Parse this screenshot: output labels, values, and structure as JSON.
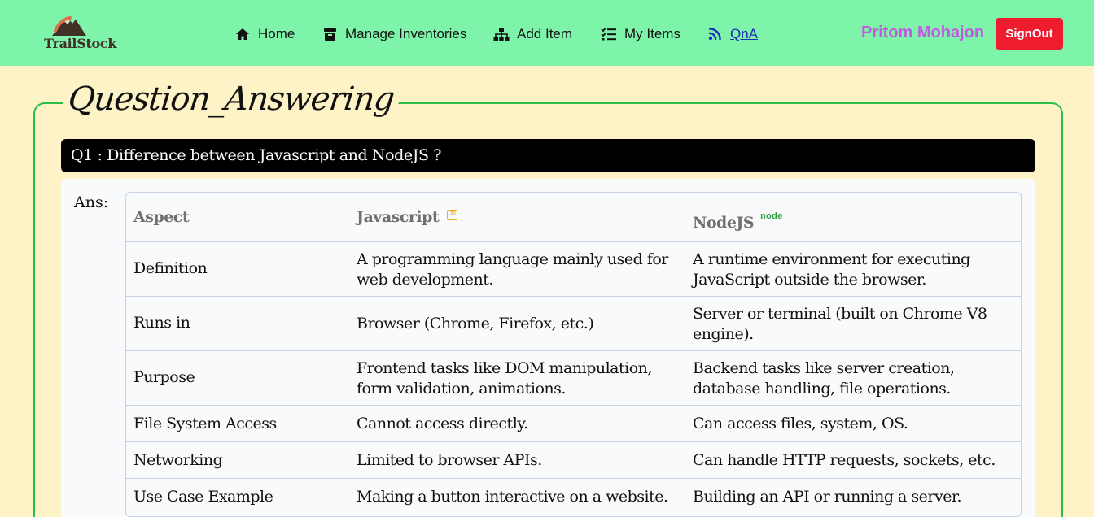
{
  "brand": {
    "name": "TrailStock",
    "logo_icon": "mountain-logo-icon"
  },
  "nav": {
    "items": [
      {
        "label": "Home",
        "icon": "home-icon"
      },
      {
        "label": "Manage Inventories",
        "icon": "archive-box-icon"
      },
      {
        "label": "Add Item",
        "icon": "sitemap-icon"
      },
      {
        "label": "My Items",
        "icon": "list-check-icon"
      },
      {
        "label": "QnA",
        "icon": "podcast-icon",
        "active": true
      }
    ],
    "user_name": "Pritom Mohajon",
    "signout_label": "SignOut"
  },
  "page": {
    "legend": "Question_Answering",
    "question": "Q1 : Difference between Javascript and NodeJS ?",
    "answer_label": "Ans:"
  },
  "table": {
    "headers": [
      "Aspect",
      "Javascript",
      "NodeJS"
    ],
    "header_badges": {
      "javascript": "JS",
      "nodejs": "node"
    },
    "rows": [
      [
        "Definition",
        "A programming language mainly used for web development.",
        "A runtime environment for executing JavaScript outside the browser."
      ],
      [
        "Runs in",
        "Browser (Chrome, Firefox, etc.)",
        "Server or terminal (built on Chrome V8 engine)."
      ],
      [
        "Purpose",
        "Frontend tasks like DOM manipulation, form validation, animations.",
        "Backend tasks like server creation, database handling, file operations."
      ],
      [
        "File System Access",
        "Cannot access directly.",
        "Can access files, system, OS."
      ],
      [
        "Networking",
        "Limited to browser APIs.",
        "Can handle HTTP requests, sockets, etc."
      ],
      [
        "Use Case Example",
        "Making a button interactive on a website.",
        "Building an API or running a server."
      ]
    ]
  },
  "colors": {
    "navbar_bg": "#7ef4aa",
    "page_bg": "#fef3c7",
    "accent_border": "#27c14a",
    "signout_bg": "#ee1c2f",
    "user_name": "#c45ae4",
    "active_link": "#1e2bb8"
  }
}
